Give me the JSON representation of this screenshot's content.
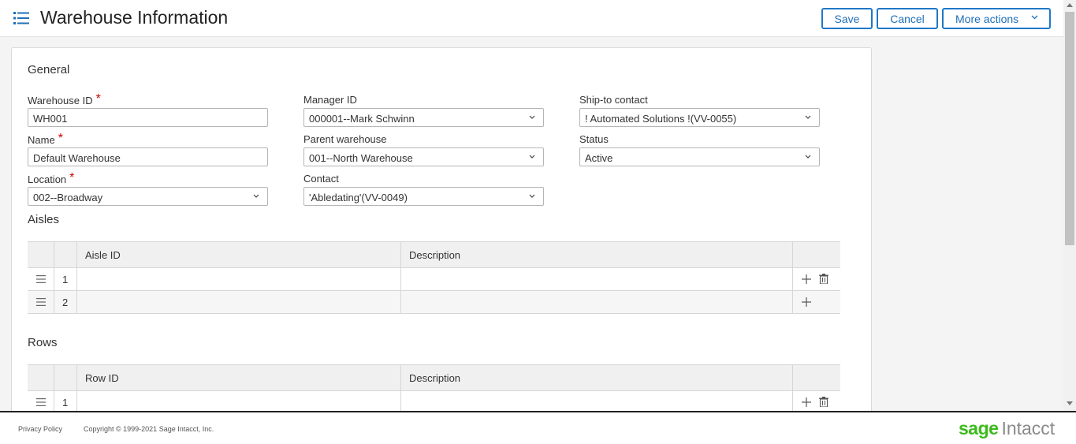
{
  "header": {
    "title": "Warehouse Information",
    "save_label": "Save",
    "cancel_label": "Cancel",
    "more_label": "More actions"
  },
  "general": {
    "section_title": "General",
    "warehouse_id": {
      "label": "Warehouse ID",
      "value": "WH001"
    },
    "name": {
      "label": "Name",
      "value": "Default Warehouse"
    },
    "location": {
      "label": "Location",
      "value": "002--Broadway"
    },
    "manager_id": {
      "label": "Manager ID",
      "value": "000001--Mark Schwinn"
    },
    "parent_warehouse": {
      "label": "Parent warehouse",
      "value": "001--North Warehouse"
    },
    "contact": {
      "label": "Contact",
      "value": "'Abledating'(VV-0049)"
    },
    "ship_to_contact": {
      "label": "Ship-to contact",
      "value": "! Automated Solutions !(VV-0055)"
    },
    "status": {
      "label": "Status",
      "value": "Active"
    },
    "required_mark": "*"
  },
  "aisles": {
    "section_title": "Aisles",
    "columns": [
      "Aisle ID",
      "Description"
    ],
    "rows": [
      {
        "num": "1",
        "id": "",
        "description": ""
      },
      {
        "num": "2",
        "id": "",
        "description": ""
      }
    ]
  },
  "rows_section": {
    "section_title": "Rows",
    "columns": [
      "Row ID",
      "Description"
    ],
    "rows": [
      {
        "num": "1",
        "id": "",
        "description": ""
      }
    ]
  },
  "footer": {
    "privacy": "Privacy Policy",
    "copyright": "Copyright © 1999-2021 Sage Intacct, Inc.",
    "logo_sage": "sage",
    "logo_intacct": "Intacct"
  },
  "colors": {
    "accent": "#1f78c8",
    "brand_green": "#3cba1c",
    "required": "#cc0000"
  },
  "icons": [
    "list-menu-icon",
    "chevron-down-icon",
    "drag-handle-icon",
    "plus-icon",
    "trash-icon"
  ]
}
